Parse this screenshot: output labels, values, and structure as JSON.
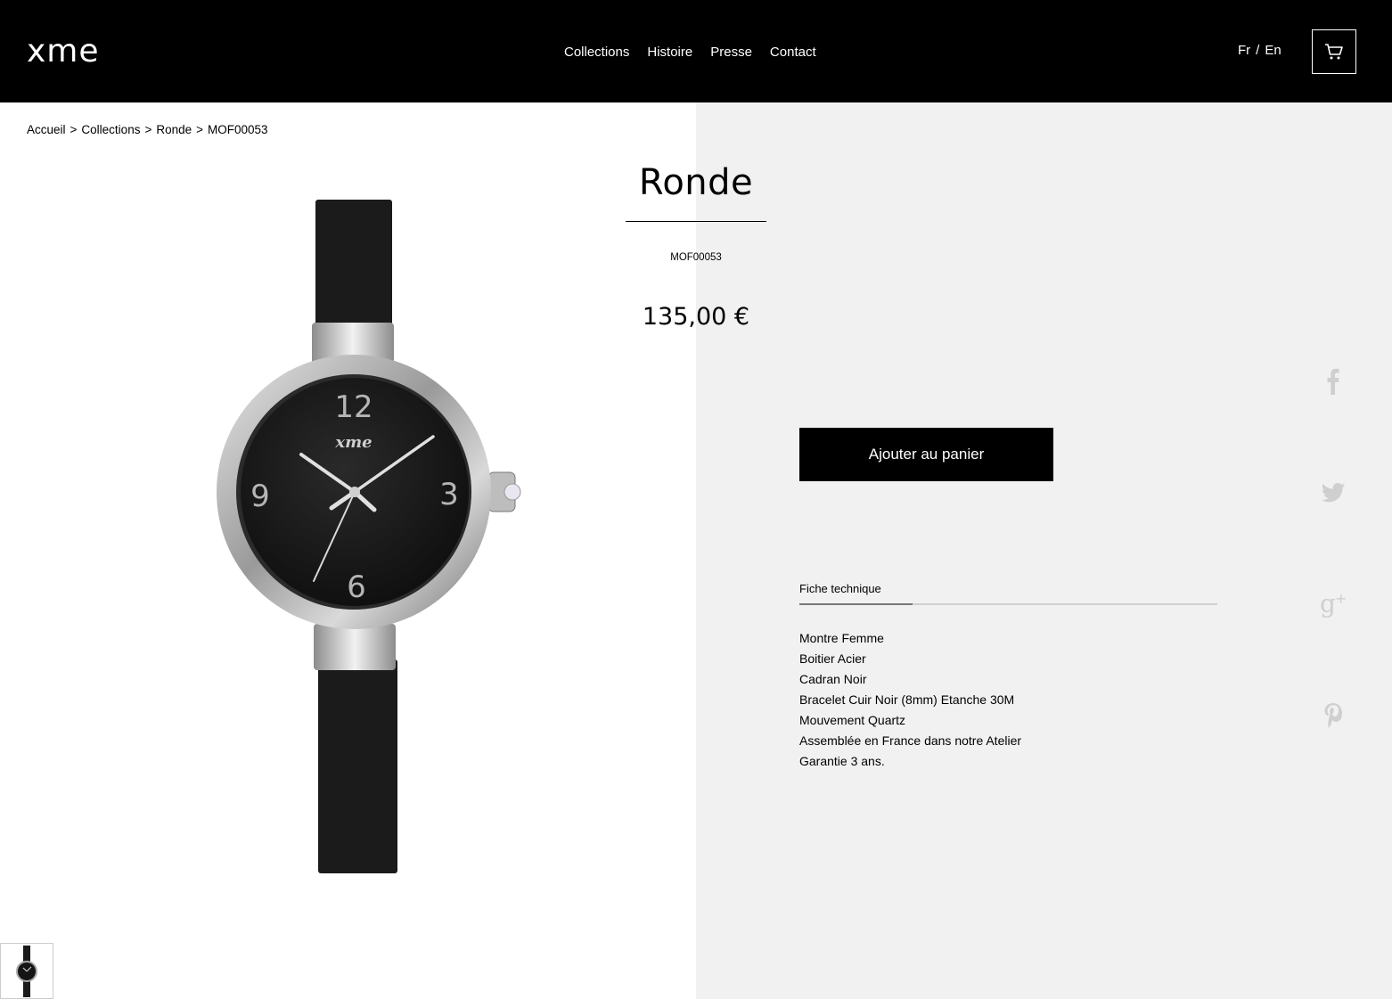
{
  "header": {
    "logo": "xme",
    "nav": [
      "Collections",
      "Histoire",
      "Presse",
      "Contact"
    ],
    "lang_fr": "Fr",
    "lang_sep": "/",
    "lang_en": "En",
    "cart_icon": "shopping-cart-icon"
  },
  "breadcrumb": {
    "items": [
      "Accueil",
      "Collections",
      "Ronde",
      "MOF00053"
    ],
    "separator": ">"
  },
  "product": {
    "title": "Ronde",
    "sku": "MOF00053",
    "price": "135,00 €",
    "add_to_cart_label": "Ajouter au panier",
    "image_brand": "xme",
    "dial_numbers": [
      "12",
      "3",
      "6",
      "9"
    ]
  },
  "tabs": {
    "active_label": "Fiche technique"
  },
  "specs": [
    "Montre Femme",
    "Boitier Acier",
    "Cadran Noir",
    "Bracelet Cuir Noir (8mm) Etanche 30M",
    "Mouvement Quartz",
    "Assemblée en France dans notre Atelier",
    "Garantie 3 ans."
  ],
  "social": [
    "facebook-icon",
    "twitter-icon",
    "google-plus-icon",
    "pinterest-icon"
  ],
  "colors": {
    "header_bg": "#000000",
    "panel_bg": "#f1f1f1",
    "social_icon": "#cfcfcf"
  }
}
